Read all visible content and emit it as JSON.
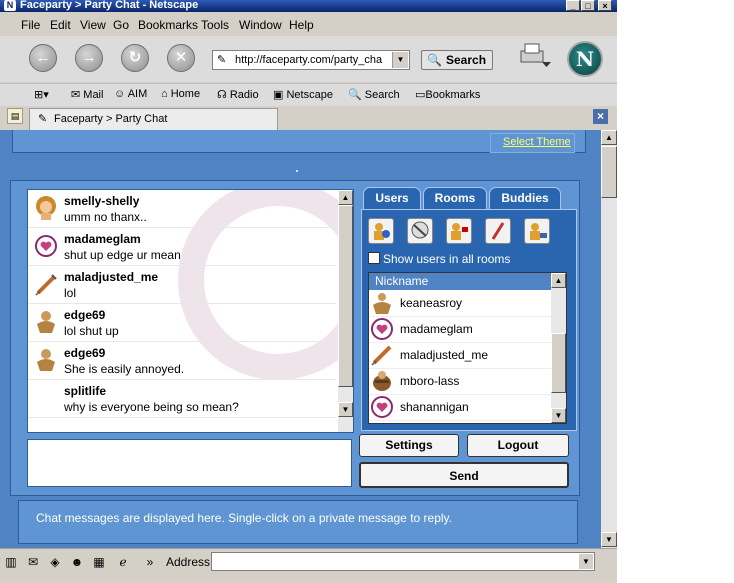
{
  "window": {
    "title": "Faceparty > Party Chat - Netscape"
  },
  "menu": [
    "File",
    "Edit",
    "View",
    "Go",
    "Bookmarks",
    "Tools",
    "Window",
    "Help"
  ],
  "nav": {
    "url": "http://faceparty.com/party_cha",
    "search_label": "Search"
  },
  "personal_toolbar": [
    "Mail",
    "AIM",
    "Home",
    "Radio",
    "Netscape",
    "Search",
    "Bookmarks"
  ],
  "tab": {
    "label": "Faceparty > Party Chat"
  },
  "page": {
    "select_theme": "Select Theme",
    "messages": [
      {
        "name": "smelly-shelly",
        "text": "umm no thanx..",
        "avatar": "girl-avatar-icon"
      },
      {
        "name": "madameglam",
        "text": "shut up edge ur mean",
        "avatar": "heart-avatar-icon"
      },
      {
        "name": "maladjusted_me",
        "text": "lol",
        "avatar": "syringe-avatar-icon"
      },
      {
        "name": "edge69",
        "text": "lol shut up",
        "avatar": "muscle-man-avatar-icon"
      },
      {
        "name": "edge69",
        "text": "She is easily annoyed.",
        "avatar": "muscle-man-avatar-icon"
      },
      {
        "name": "splitlife",
        "text": "why is everyone being so mean?",
        "avatar": ""
      }
    ],
    "tabs": {
      "users": "Users",
      "rooms": "Rooms",
      "buddies": "Buddies"
    },
    "show_all": "Show users in all rooms",
    "nickname_header": "Nickname",
    "users": [
      {
        "name": "keaneasroy",
        "avatar": "muscle-man-avatar-icon"
      },
      {
        "name": "madameglam",
        "avatar": "heart-avatar-icon"
      },
      {
        "name": "maladjusted_me",
        "avatar": "syringe-avatar-icon"
      },
      {
        "name": "mboro-lass",
        "avatar": "barrel-avatar-icon"
      },
      {
        "name": "shanannigan",
        "avatar": "heart-avatar-icon"
      }
    ],
    "settings": "Settings",
    "logout": "Logout",
    "send": "Send",
    "status": "Chat messages are displayed here.  Single-click on a private message to reply."
  },
  "bottom": {
    "address_label": "Address",
    "address_value": ""
  }
}
